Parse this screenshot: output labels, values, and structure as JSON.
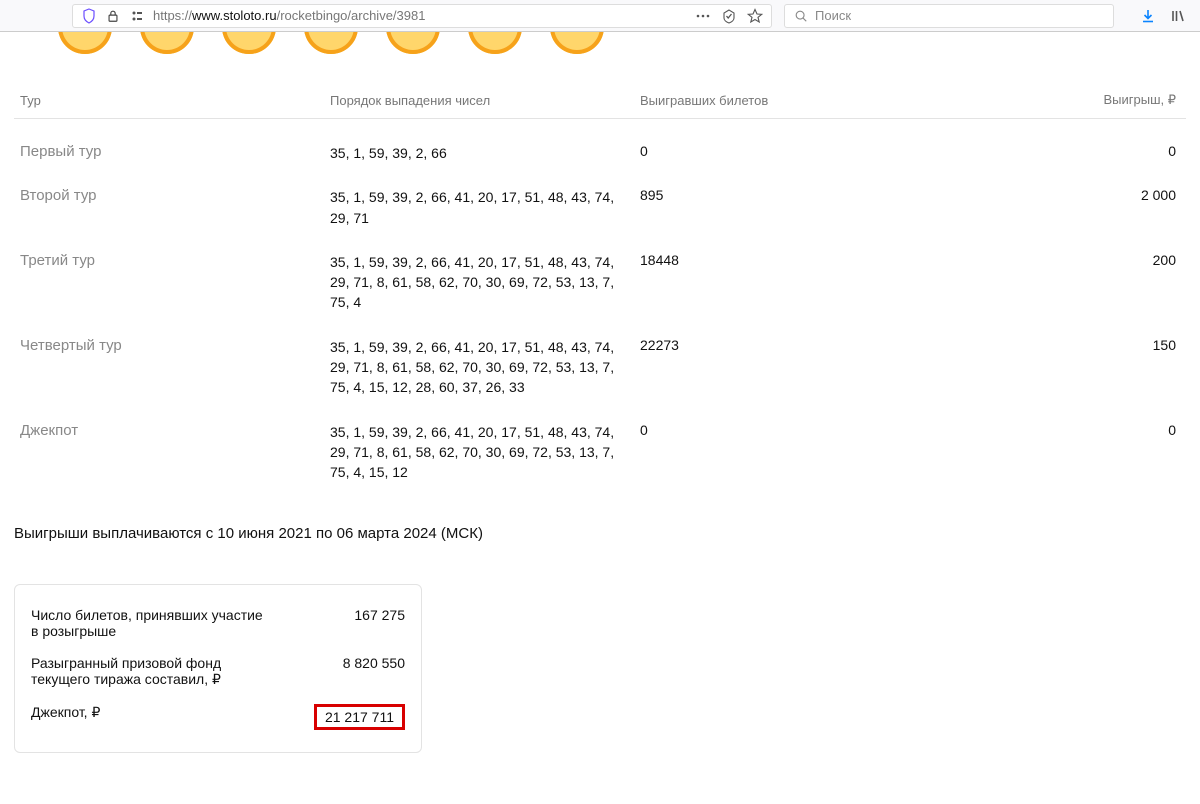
{
  "browser": {
    "url_host": "www.stoloto.ru",
    "url_rest": "/rocketbingo/archive/3981",
    "protocol": "https://",
    "search_placeholder": "Поиск"
  },
  "table": {
    "headers": {
      "round": "Тур",
      "order": "Порядок выпадения чисел",
      "winners": "Выигравших билетов",
      "prize": "Выигрыш, ₽"
    },
    "rows": [
      {
        "name": "Первый тур",
        "numbers": "35, 1, 59, 39, 2, 66",
        "winners": "0",
        "prize": "0"
      },
      {
        "name": "Второй тур",
        "numbers": "35, 1, 59, 39, 2, 66, 41, 20, 17, 51, 48, 43, 74, 29, 71",
        "winners": "895",
        "prize": "2 000"
      },
      {
        "name": "Третий тур",
        "numbers": "35, 1, 59, 39, 2, 66, 41, 20, 17, 51, 48, 43, 74, 29, 71, 8, 61, 58, 62, 70, 30, 69, 72, 53, 13, 7, 75, 4",
        "winners": "18448",
        "prize": "200"
      },
      {
        "name": "Четвертый тур",
        "numbers": "35, 1, 59, 39, 2, 66, 41, 20, 17, 51, 48, 43, 74, 29, 71, 8, 61, 58, 62, 70, 30, 69, 72, 53, 13, 7, 75, 4, 15, 12, 28, 60, 37, 26, 33",
        "winners": "22273",
        "prize": "150"
      },
      {
        "name": "Джекпот",
        "numbers": "35, 1, 59, 39, 2, 66, 41, 20, 17, 51, 48, 43, 74, 29, 71, 8, 61, 58, 62, 70, 30, 69, 72, 53, 13, 7, 75, 4, 15, 12",
        "winners": "0",
        "prize": "0"
      }
    ]
  },
  "payout_note": "Выигрыши выплачиваются с 10 июня 2021 по 06 марта 2024 (МСК)",
  "summary": {
    "tickets_label": "Число билетов, принявших участие в розыгрыше",
    "tickets_value": "167 275",
    "fund_label": "Разыгранный призовой фонд текущего тиража составил, ₽",
    "fund_value": "8 820 550",
    "jackpot_label": "Джекпот, ₽",
    "jackpot_value": "21 217 711"
  }
}
